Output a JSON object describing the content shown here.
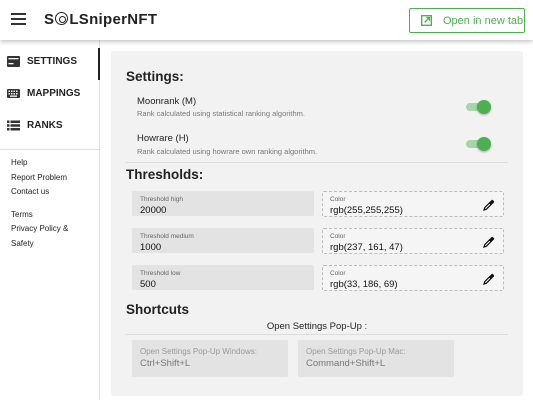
{
  "header": {
    "brand": {
      "part1": "S",
      "part2": "LSniperNFT"
    },
    "open_tab_label": "Open in new tab"
  },
  "sidebar": {
    "items": [
      {
        "label": "SETTINGS",
        "icon": "settings-card-icon",
        "active": true
      },
      {
        "label": "MAPPINGS",
        "icon": "keyboard-icon",
        "active": false
      },
      {
        "label": "RANKS",
        "icon": "list-icon",
        "active": false
      }
    ],
    "links": [
      "Help",
      "Report Problem",
      "Contact us",
      "Terms",
      "Privacy Policy &",
      "Safety"
    ]
  },
  "settings": {
    "title": "Settings:",
    "toggles": [
      {
        "title": "Moonrank (M)",
        "description": "Rank calculated using statistical ranking algorithm.",
        "on": true
      },
      {
        "title": "Howrare (H)",
        "description": "Rank calculated using howrare own ranking algorithm.",
        "on": true
      }
    ]
  },
  "thresholds": {
    "title": "Thresholds:",
    "rows": [
      {
        "label": "Threshold high",
        "value": "20000",
        "color_label": "Color",
        "color_value": "rgb(255,255,255)"
      },
      {
        "label": "Threshold medium",
        "value": "1000",
        "color_label": "Color",
        "color_value": "rgb(237, 161, 47)"
      },
      {
        "label": "Threshold low",
        "value": "500",
        "color_label": "Color",
        "color_value": "rgb(33, 186, 69)"
      }
    ]
  },
  "shortcuts": {
    "title": "Shortcuts",
    "heading": "Open Settings Pop-Up :",
    "windows": {
      "placeholder": "Open Settings Pop-Up Windows:",
      "value": "Ctrl+Shift+L"
    },
    "mac": {
      "placeholder": "Open Settings Pop-Up Mac:",
      "value": "Command+Shift+L"
    }
  },
  "colors": {
    "accent": "#4caf50",
    "accent_light": "#a5d6a7"
  }
}
